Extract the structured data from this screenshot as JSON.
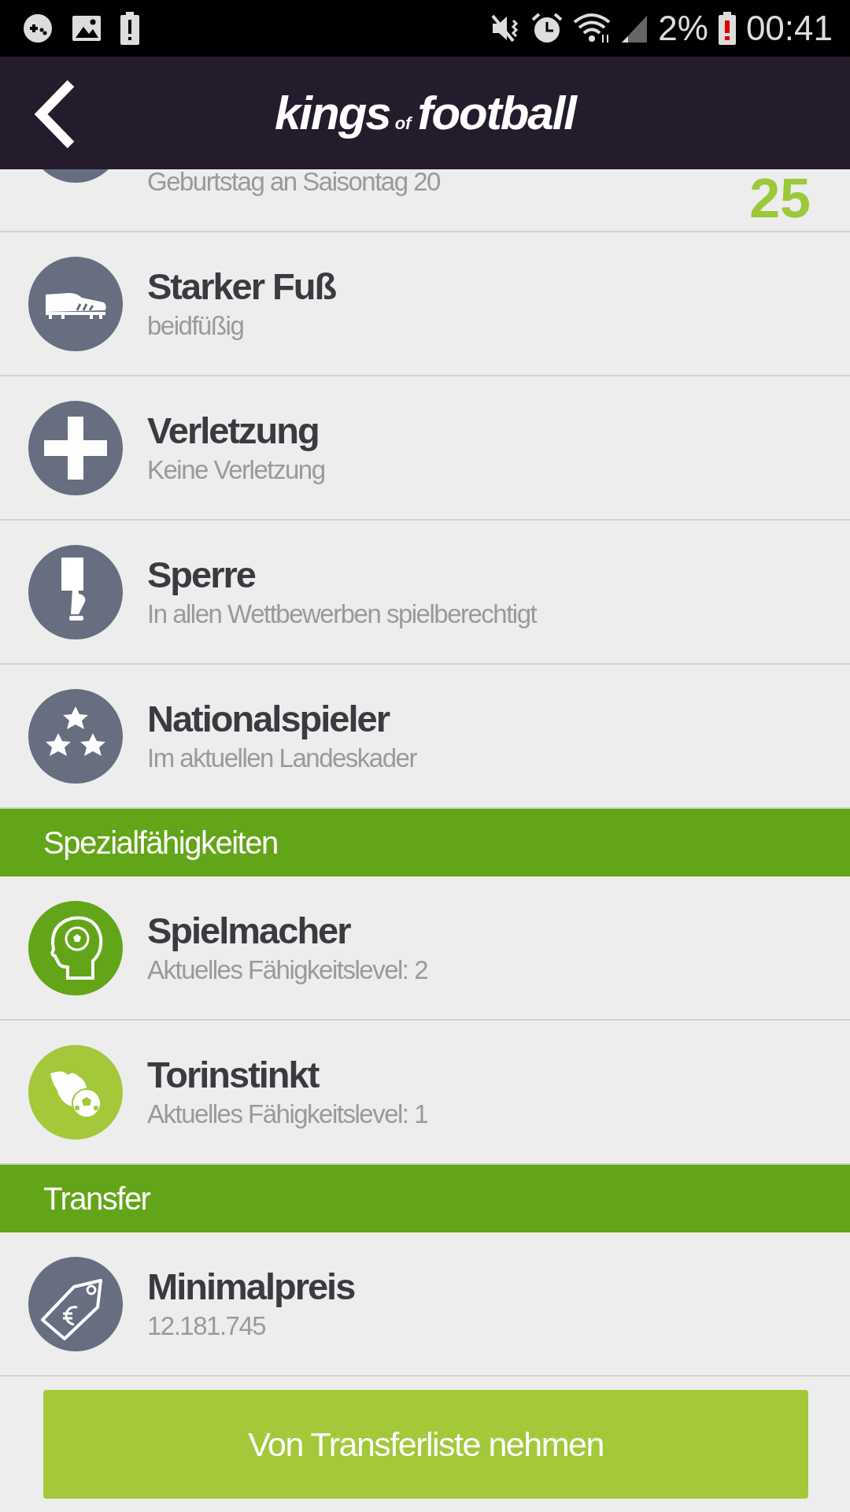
{
  "status_bar": {
    "battery": "2%",
    "time": "00:41"
  },
  "header": {
    "logo_first": "kings",
    "logo_small": "of",
    "logo_last": "football"
  },
  "sections": [
    {
      "rows": [
        {
          "subtitle": "Geburtstag an Saisontag 20",
          "value": "25",
          "color": "#666e80"
        },
        {
          "title": "Starker Fuß",
          "subtitle": "beidfüßig",
          "color": "#666e80"
        },
        {
          "title": "Verletzung",
          "subtitle": "Keine Verletzung",
          "color": "#666e80"
        },
        {
          "title": "Sperre",
          "subtitle": "In allen Wettbewerben spielberechtigt",
          "color": "#666e80"
        },
        {
          "title": "Nationalspieler",
          "subtitle": "Im aktuellen Landeskader",
          "color": "#666e80"
        }
      ]
    },
    {
      "title": "Spezialfähigkeiten",
      "rows": [
        {
          "title": "Spielmacher",
          "subtitle": "Aktuelles Fähigkeitslevel: 2",
          "color": "#63a518"
        },
        {
          "title": "Torinstinkt",
          "subtitle": "Aktuelles Fähigkeitslevel: 1",
          "color": "#a3c83a"
        }
      ]
    },
    {
      "title": "Transfer",
      "rows": [
        {
          "title": "Minimalpreis",
          "subtitle": "12.181.745",
          "color": "#666e80"
        }
      ]
    }
  ],
  "button": "Von Transferliste nehmen"
}
